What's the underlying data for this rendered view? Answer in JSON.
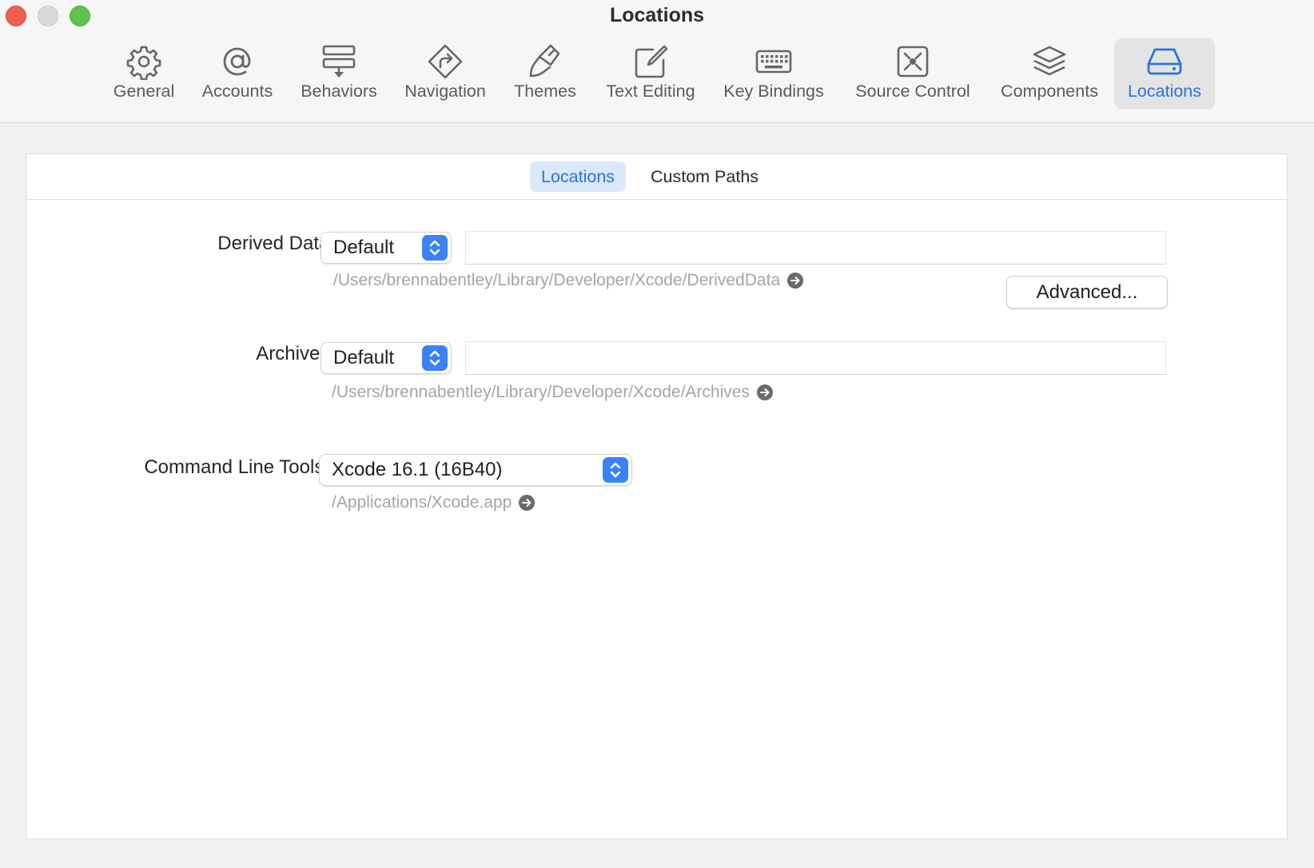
{
  "window": {
    "title": "Locations"
  },
  "toolbar": {
    "items": [
      {
        "label": "General",
        "icon": "gear-icon"
      },
      {
        "label": "Accounts",
        "icon": "at-sign-icon"
      },
      {
        "label": "Behaviors",
        "icon": "behaviors-icon"
      },
      {
        "label": "Navigation",
        "icon": "navigation-icon"
      },
      {
        "label": "Themes",
        "icon": "paintbrush-icon"
      },
      {
        "label": "Text Editing",
        "icon": "pencil-square-icon"
      },
      {
        "label": "Key Bindings",
        "icon": "keyboard-icon"
      },
      {
        "label": "Source Control",
        "icon": "source-control-icon"
      },
      {
        "label": "Components",
        "icon": "layers-icon"
      },
      {
        "label": "Locations",
        "icon": "drive-icon"
      }
    ],
    "selected": "Locations",
    "accent_color": "#2a73e0"
  },
  "tabs": {
    "items": [
      "Locations",
      "Custom Paths"
    ],
    "selected": "Locations"
  },
  "derived_data": {
    "label": "Derived Data:",
    "popup_value": "Default",
    "field_value": "",
    "path": "/Users/brennabentley/Library/Developer/Xcode/DerivedData",
    "advanced_label": "Advanced..."
  },
  "archives": {
    "label": "Archives:",
    "popup_value": "Default",
    "field_value": "",
    "path": "/Users/brennabentley/Library/Developer/Xcode/Archives"
  },
  "command_line_tools": {
    "label": "Command Line Tools:",
    "popup_value": "Xcode 16.1 (16B40)",
    "path": "/Applications/Xcode.app"
  }
}
